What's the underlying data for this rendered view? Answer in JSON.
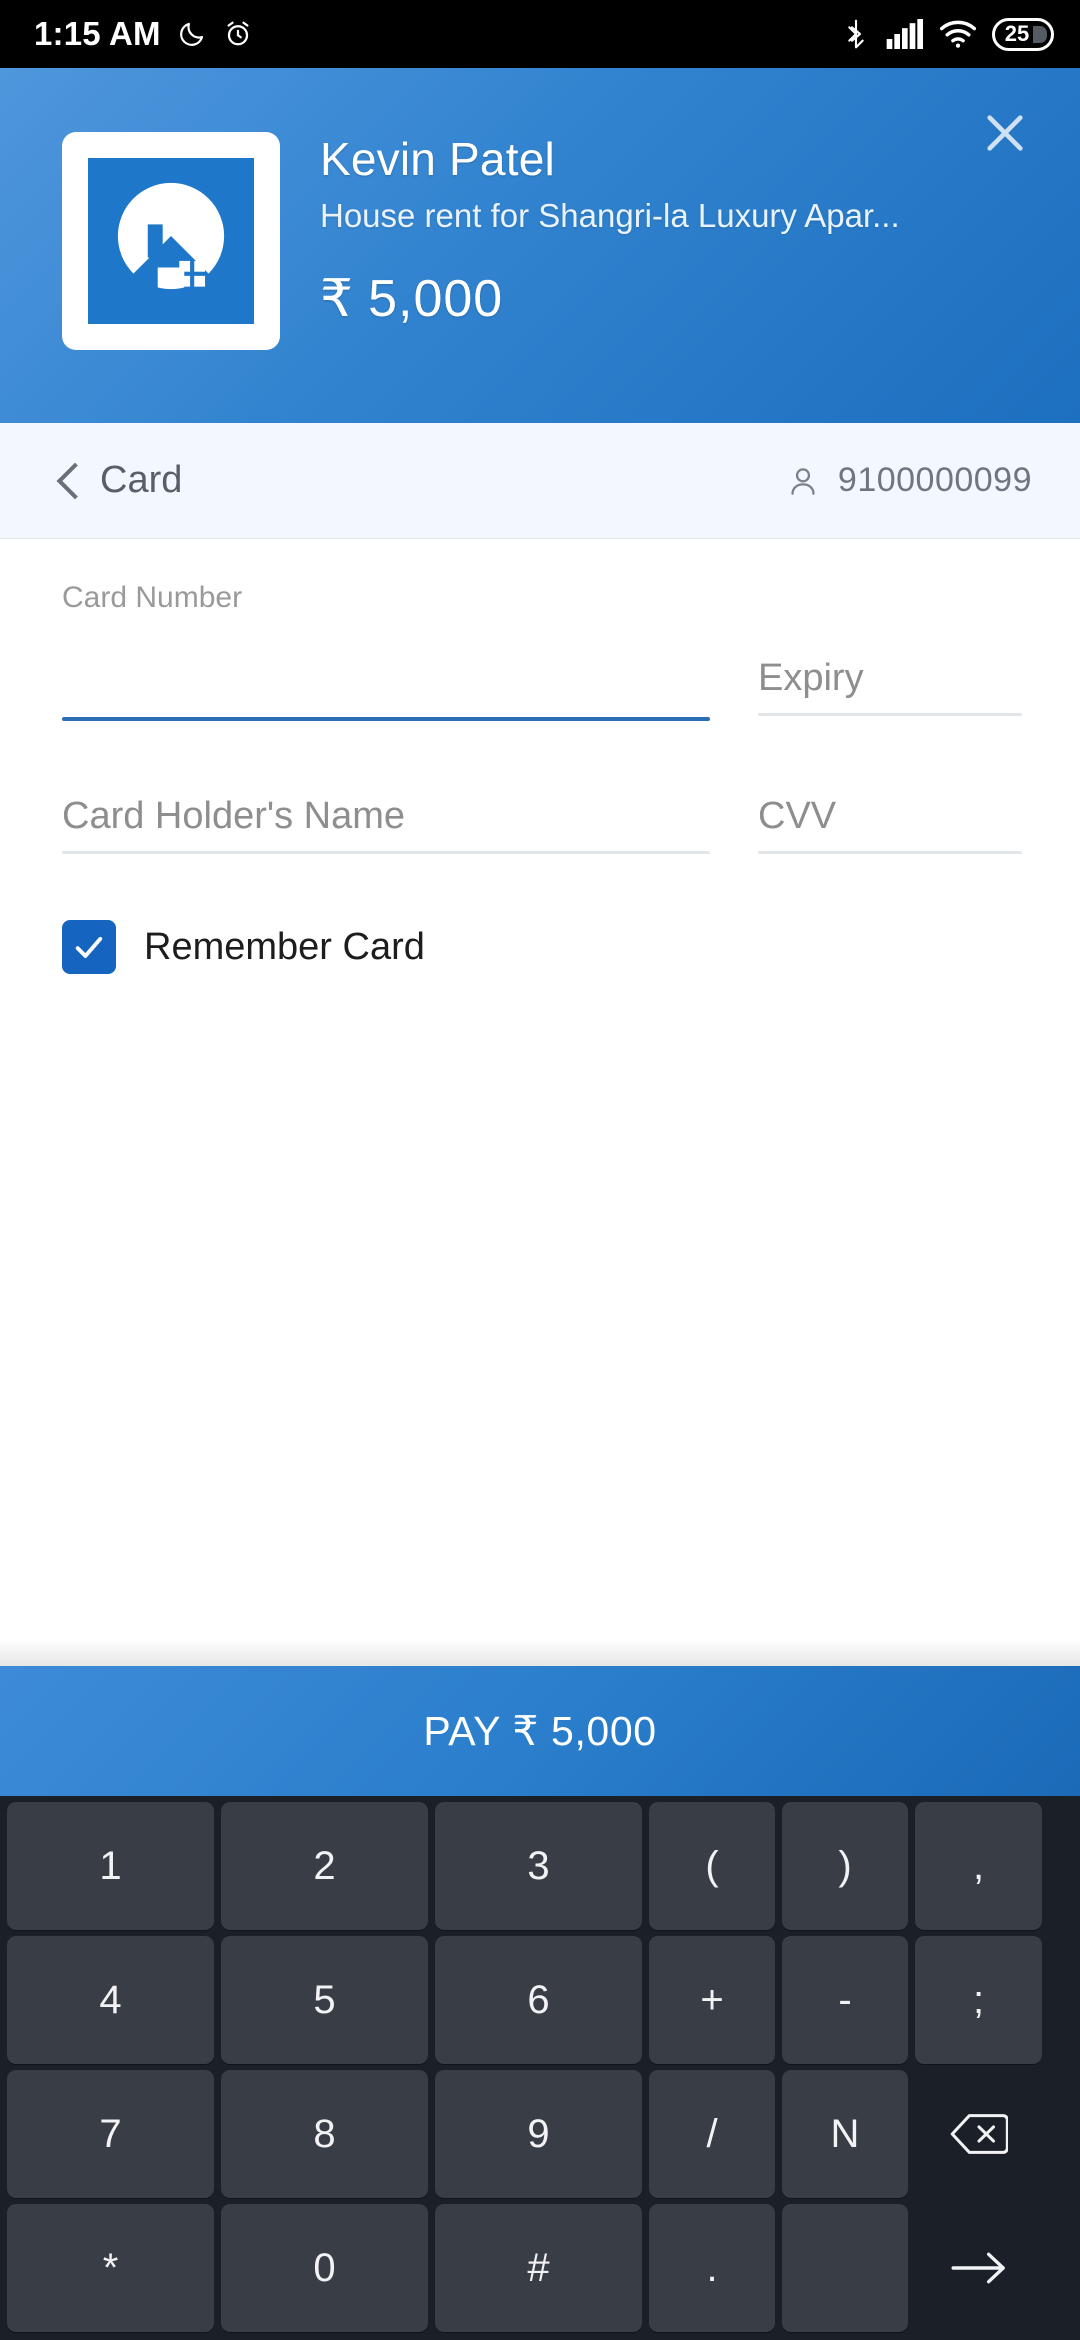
{
  "status_bar": {
    "time": "1:15 AM",
    "icons": [
      "moon-icon",
      "alarm-icon",
      "bluetooth-icon",
      "signal-icon",
      "wifi-icon"
    ],
    "battery_percent": "25"
  },
  "header": {
    "merchant_name": "Kevin Patel",
    "purpose": "House rent for Shangri-la Luxury Apar...",
    "currency_symbol": "₹",
    "amount": "5,000",
    "close_icon": "close-icon",
    "logo_icon": "house-logo-icon",
    "gradient_from": "#4f96dd",
    "gradient_to": "#1d6fbf"
  },
  "section": {
    "back_icon": "chevron-left-icon",
    "title": "Card",
    "user_icon": "person-icon",
    "phone": "9100000099",
    "background": "#f2f8fd"
  },
  "form": {
    "card_number": {
      "label": "Card Number",
      "value": "",
      "focused": true,
      "accent": "#2a6db5"
    },
    "expiry": {
      "placeholder": "Expiry",
      "value": ""
    },
    "card_holder": {
      "placeholder": "Card Holder's Name",
      "value": ""
    },
    "cvv": {
      "placeholder": "CVV",
      "value": ""
    },
    "remember_card": {
      "label": "Remember Card",
      "checked": true,
      "check_icon": "check-icon",
      "color": "#1565c0"
    }
  },
  "pay_button": {
    "label": "PAY ₹ 5,000",
    "color": "#2a7ecb"
  },
  "keyboard": {
    "background": "#1b1f28",
    "key_color": "#393d46",
    "rows": [
      [
        {
          "label": "1",
          "width": "num"
        },
        {
          "label": "2",
          "width": "num"
        },
        {
          "label": "3",
          "width": "num"
        },
        {
          "label": "(",
          "width": "sym"
        },
        {
          "label": ")",
          "width": "sym"
        },
        {
          "label": ",",
          "width": "sym2"
        }
      ],
      [
        {
          "label": "4",
          "width": "num"
        },
        {
          "label": "5",
          "width": "num"
        },
        {
          "label": "6",
          "width": "num"
        },
        {
          "label": "+",
          "width": "sym"
        },
        {
          "label": "-",
          "width": "sym"
        },
        {
          "label": ";",
          "width": "sym2"
        }
      ],
      [
        {
          "label": "7",
          "width": "num"
        },
        {
          "label": "8",
          "width": "num"
        },
        {
          "label": "9",
          "width": "num"
        },
        {
          "label": "/",
          "width": "sym"
        },
        {
          "label": "N",
          "width": "sym"
        },
        {
          "label": "",
          "width": "sym2",
          "icon": "backspace-icon"
        }
      ],
      [
        {
          "label": "*",
          "width": "num"
        },
        {
          "label": "0",
          "width": "num"
        },
        {
          "label": "#",
          "width": "num"
        },
        {
          "label": ".",
          "width": "sym"
        },
        {
          "label": "",
          "width": "sym"
        },
        {
          "label": "",
          "width": "sym2",
          "icon": "enter-arrow-icon"
        }
      ]
    ]
  }
}
